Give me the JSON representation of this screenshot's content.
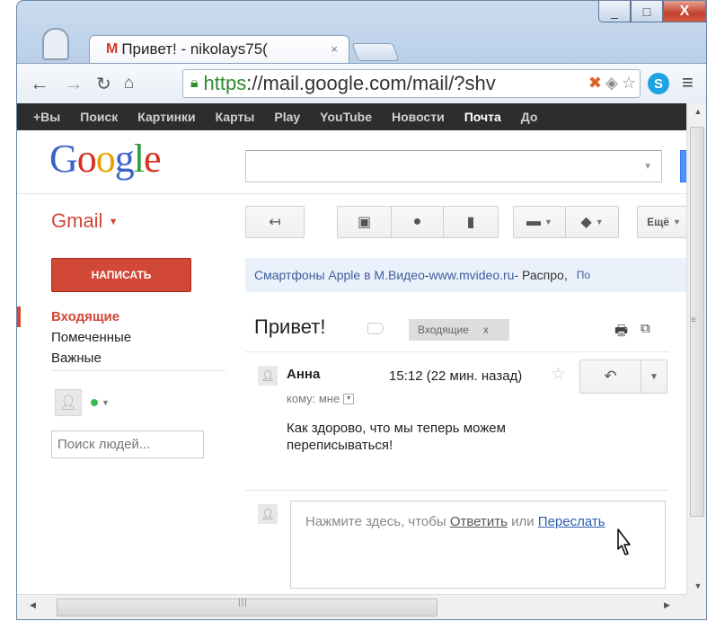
{
  "browser": {
    "tab_title": "Привет! - nikolays75(",
    "tab_close": "×",
    "url_https": "https",
    "url_rest": "://mail.google.com/mail/?shv",
    "window_controls": {
      "minimize": "_",
      "maximize": "□",
      "close": "X"
    }
  },
  "google_bar": {
    "items": [
      "+Вы",
      "Поиск",
      "Картинки",
      "Карты",
      "Play",
      "YouTube",
      "Новости",
      "Почта",
      "До"
    ],
    "active": "Почта"
  },
  "logo": {
    "letters": [
      "G",
      "o",
      "o",
      "g",
      "l",
      "e"
    ]
  },
  "gmail_label": "Gmail",
  "toolbar": {
    "more_label": "Ещё"
  },
  "compose_label": "НАПИСАТЬ",
  "nav": {
    "items": [
      "Входящие",
      "Помеченные",
      "Важные"
    ]
  },
  "people_search_placeholder": "Поиск людей...",
  "ad": {
    "link": "Смартфоны Apple в М.Видео",
    "sep": " - ",
    "url": "www.mvideo.ru",
    "text": " - Распро,",
    "more": "По"
  },
  "message": {
    "subject": "Привет!",
    "label": "Входящие",
    "label_remove": "x",
    "sender": "Анна",
    "time": "15:12 (22 мин. назад)",
    "to": "кому: мне",
    "body": "Как здорово, что мы теперь можем переписываться!"
  },
  "reply": {
    "prefix": "Нажмите здесь, чтобы ",
    "reply_link": "Ответить",
    "or": " или ",
    "forward_link": "Переслать"
  },
  "colors": {
    "gmail_red": "#d14836",
    "compose_red": "#d14836",
    "gbar": "#2d2d2d",
    "link_blue": "#3d5e9e"
  }
}
